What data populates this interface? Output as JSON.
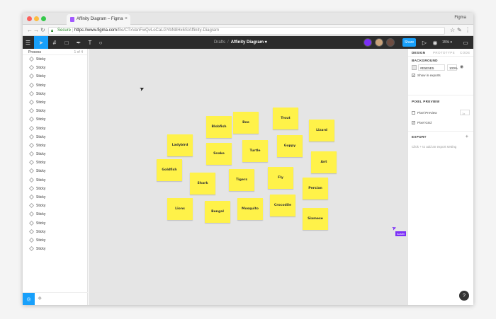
{
  "browser": {
    "tab_title": "Affinity Diagram – Figma",
    "profile_name": "Figma",
    "secure_label": "Secure",
    "url_domain": "https://www.figma.com",
    "url_path": "/file/CTxVanFwQvLoCaLGYbN8Hx6S/Affinity-Diagram"
  },
  "toolbar": {
    "breadcrumb": "Drafts",
    "separator": "/",
    "file_name": "Affinity Diagram ▾",
    "share_label": "Share",
    "zoom": "15% ▾"
  },
  "left_panel": {
    "page_name": "Process",
    "page_count": "1 of 4",
    "layers": [
      "Sticky",
      "Sticky",
      "Sticky",
      "Sticky",
      "Sticky",
      "Sticky",
      "Sticky",
      "Sticky",
      "Sticky",
      "Sticky",
      "Sticky",
      "Sticky",
      "Sticky",
      "Sticky",
      "Sticky",
      "Sticky",
      "Sticky",
      "Sticky",
      "Sticky",
      "Sticky",
      "Sticky",
      "Sticky",
      "Sticky"
    ]
  },
  "canvas": {
    "background": "#e5e5e5",
    "sticky_color": "#fff249",
    "stickies": [
      "Blobfish",
      "Bee",
      "Trout",
      "Lizard",
      "Ladybird",
      "Snake",
      "Turtle",
      "Guppy",
      "Goldfish",
      "Ant",
      "Shark",
      "Tigers",
      "Fly",
      "Persian",
      "Lions",
      "Bengal",
      "Mosquito",
      "Crocodile",
      "Siamese"
    ],
    "collaborator_tag": "Austin"
  },
  "right_panel": {
    "tabs": [
      "DESIGN",
      "PROTOTYPE",
      "CODE"
    ],
    "background_heading": "BACKGROUND",
    "bg_hex": "#E5E5E5",
    "bg_opacity": "100%",
    "show_in_exports": "Show in exports",
    "pixel_preview_heading": "PIXEL PREVIEW",
    "pixel_preview_label": "Pixel Preview",
    "pixel_preview_value": "1x",
    "pixel_grid_label": "Pixel Grid",
    "export_heading": "EXPORT",
    "export_hint": "Click + to add an export setting"
  },
  "help_label": "?"
}
